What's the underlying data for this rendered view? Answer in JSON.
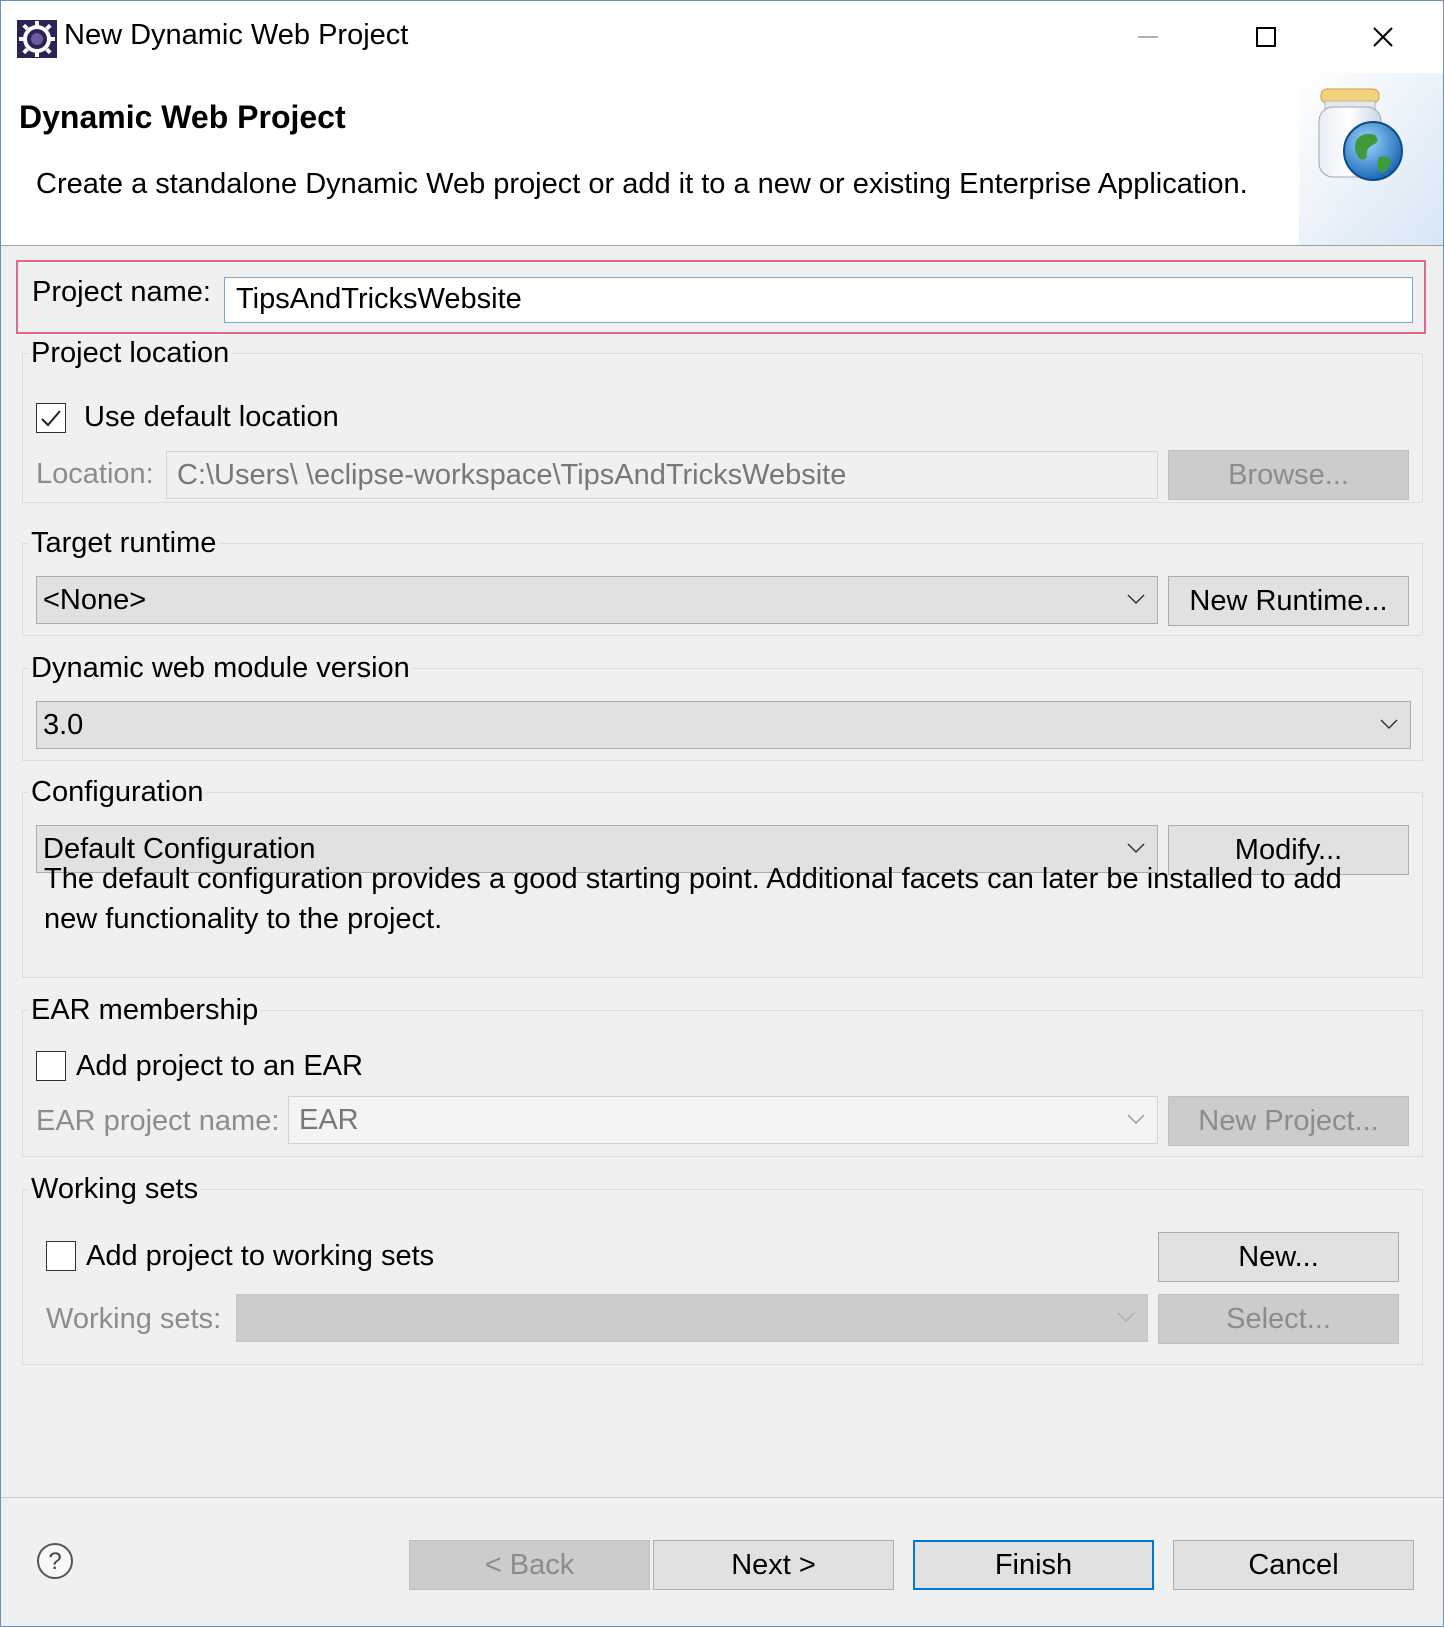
{
  "window": {
    "title": "New Dynamic Web Project"
  },
  "header": {
    "title": "Dynamic Web Project",
    "description": "Create a standalone Dynamic Web project or add it to a new or existing Enterprise Application."
  },
  "project_name": {
    "label": "Project name:",
    "value": "TipsAndTricksWebsite"
  },
  "project_location": {
    "group_title": "Project location",
    "use_default_label": "Use default location",
    "use_default_checked": true,
    "location_label": "Location:",
    "location_value": "C:\\Users\\        \\eclipse-workspace\\TipsAndTricksWebsite",
    "browse_label": "Browse..."
  },
  "target_runtime": {
    "group_title": "Target runtime",
    "selected": "<None>",
    "new_runtime_label": "New Runtime..."
  },
  "module_version": {
    "group_title": "Dynamic web module version",
    "selected": "3.0"
  },
  "configuration": {
    "group_title": "Configuration",
    "selected": "Default Configuration",
    "modify_label": "Modify...",
    "description": "The default configuration provides a good starting point. Additional facets can later be installed to add new functionality to the project."
  },
  "ear": {
    "group_title": "EAR membership",
    "add_label": "Add project to an EAR",
    "add_checked": false,
    "name_label": "EAR project name:",
    "name_value": "EAR",
    "new_project_label": "New Project..."
  },
  "working_sets": {
    "group_title": "Working sets",
    "add_label": "Add project to working sets",
    "add_checked": false,
    "new_label": "New...",
    "sets_label": "Working sets:",
    "sets_value": "",
    "select_label": "Select..."
  },
  "footer": {
    "back_label": "< Back",
    "next_label": "Next >",
    "finish_label": "Finish",
    "cancel_label": "Cancel"
  },
  "icons": {
    "app": "eclipse-icon",
    "wizard": "web-project-jar-globe-icon",
    "help": "help-icon",
    "minimize": "minimize-icon",
    "maximize": "maximize-icon",
    "close": "close-icon"
  },
  "colors": {
    "highlight_border": "#e06b86",
    "default_button_border": "#0078d7",
    "dialog_background": "#f0f0f0"
  }
}
